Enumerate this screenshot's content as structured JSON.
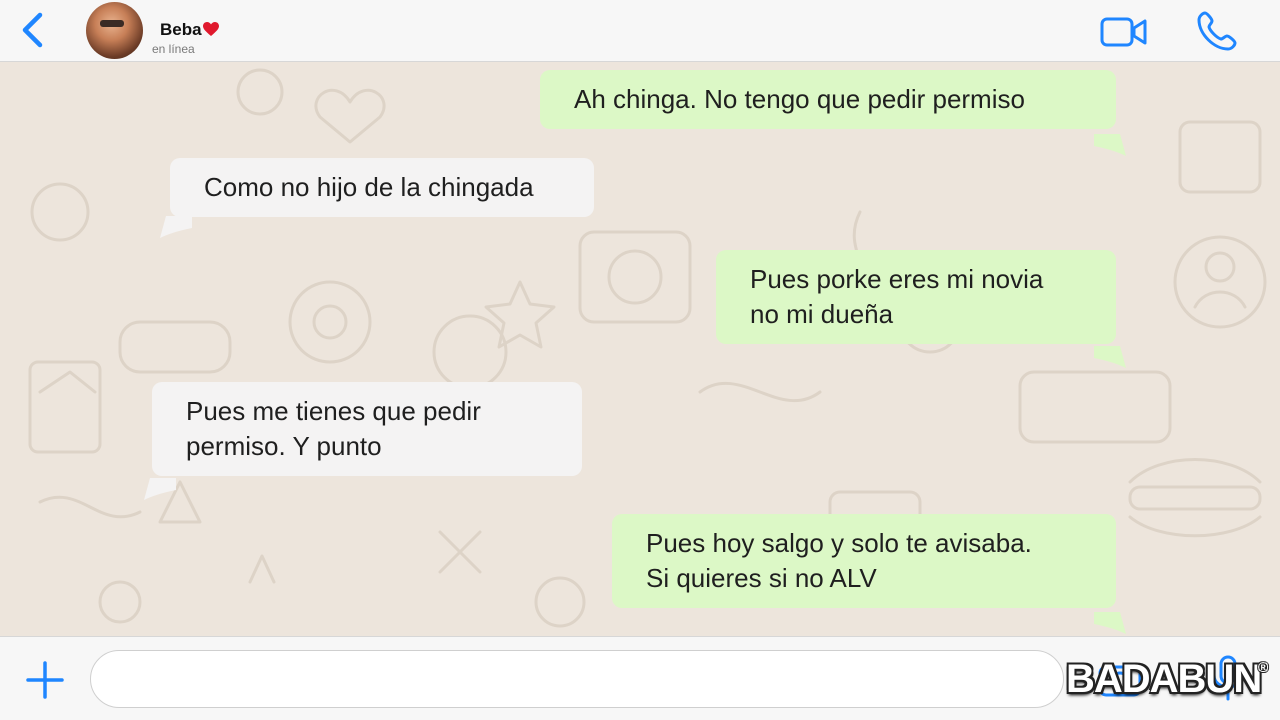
{
  "header": {
    "contact_name": "Beba",
    "status": "en línea"
  },
  "messages": [
    {
      "direction": "outgoing",
      "text": "Ah chinga. No tengo que pedir permiso"
    },
    {
      "direction": "incoming",
      "text": "Como no hijo de la chingada"
    },
    {
      "direction": "outgoing",
      "text": "Pues porke eres mi novia\nno mi dueña"
    },
    {
      "direction": "incoming",
      "text": "Pues me tienes que pedir\npermiso. Y punto"
    },
    {
      "direction": "outgoing",
      "text": "Pues hoy salgo y solo te avisaba.\nSi quieres si no ALV"
    }
  ],
  "composer": {
    "value": "",
    "placeholder": ""
  },
  "watermark": {
    "text": "BADABUN",
    "mark": "®"
  },
  "icons": {
    "back": "chevron-left-icon",
    "heart": "heart-icon",
    "video": "video-camera-icon",
    "call": "phone-icon",
    "plus": "plus-icon",
    "camera": "camera-icon",
    "mic": "microphone-icon"
  },
  "colors": {
    "accent": "#1f86ff",
    "outgoing_bubble": "#dcf8c6",
    "incoming_bubble": "#f4f3f3",
    "wallpaper": "#ede5dc",
    "heart": "#e0192d"
  }
}
